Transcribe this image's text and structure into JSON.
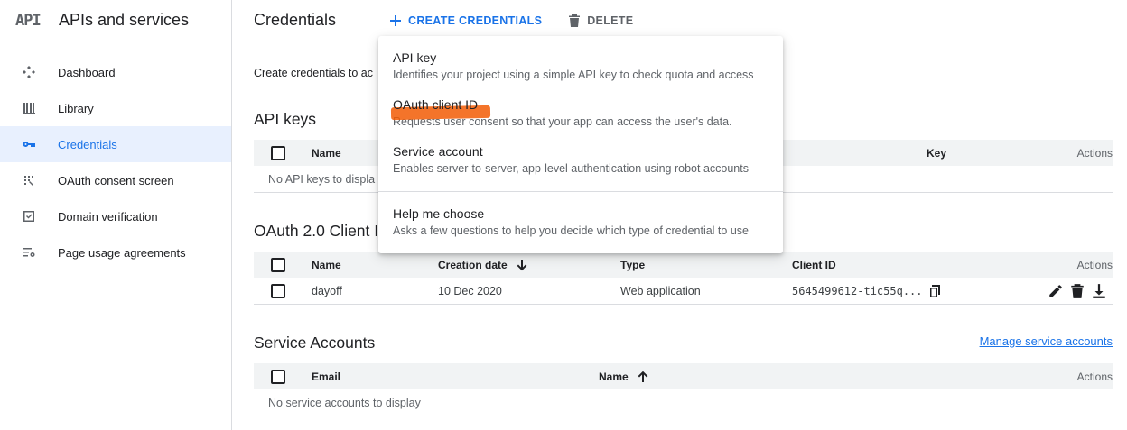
{
  "brand": {
    "logo": "API",
    "title": "APIs and services"
  },
  "sidebar": {
    "items": [
      {
        "label": "Dashboard",
        "icon": "dashboard-icon"
      },
      {
        "label": "Library",
        "icon": "library-icon"
      },
      {
        "label": "Credentials",
        "icon": "key-icon",
        "active": true
      },
      {
        "label": "OAuth consent screen",
        "icon": "consent-icon"
      },
      {
        "label": "Domain verification",
        "icon": "checkbox-icon"
      },
      {
        "label": "Page usage agreements",
        "icon": "settings-list-icon"
      }
    ]
  },
  "header": {
    "title": "Credentials",
    "create_label": "CREATE CREDENTIALS",
    "delete_label": "DELETE"
  },
  "main": {
    "intro": "Create credentials to ac",
    "api_keys": {
      "title": "API keys",
      "columns": {
        "name": "Name",
        "key": "Key",
        "actions": "Actions"
      },
      "empty": "No API keys to displa"
    },
    "oauth": {
      "title": "OAuth 2.0 Client I",
      "columns": {
        "name": "Name",
        "created": "Creation date",
        "type": "Type",
        "client_id": "Client ID",
        "actions": "Actions"
      },
      "rows": [
        {
          "name": "dayoff",
          "created": "10 Dec 2020",
          "type": "Web application",
          "client_id": "5645499612-tic55q..."
        }
      ]
    },
    "service_accounts": {
      "title": "Service Accounts",
      "manage_link": "Manage service accounts",
      "columns": {
        "email": "Email",
        "name": "Name",
        "actions": "Actions"
      },
      "empty": "No service accounts to display"
    }
  },
  "dropdown": {
    "items": [
      {
        "title": "API key",
        "desc": "Identifies your project using a simple API key to check quota and access"
      },
      {
        "title": "OAuth client ID",
        "desc": "Requests user consent so that your app can access the user's data."
      },
      {
        "title": "Service account",
        "desc": "Enables server-to-server, app-level authentication using robot accounts"
      }
    ],
    "help": {
      "title": "Help me choose",
      "desc": "Asks a few questions to help you decide which type of credential to use"
    }
  },
  "colors": {
    "accent": "#1a73e8",
    "active_bg": "#e8f0fe",
    "highlight": "#f25c05"
  }
}
